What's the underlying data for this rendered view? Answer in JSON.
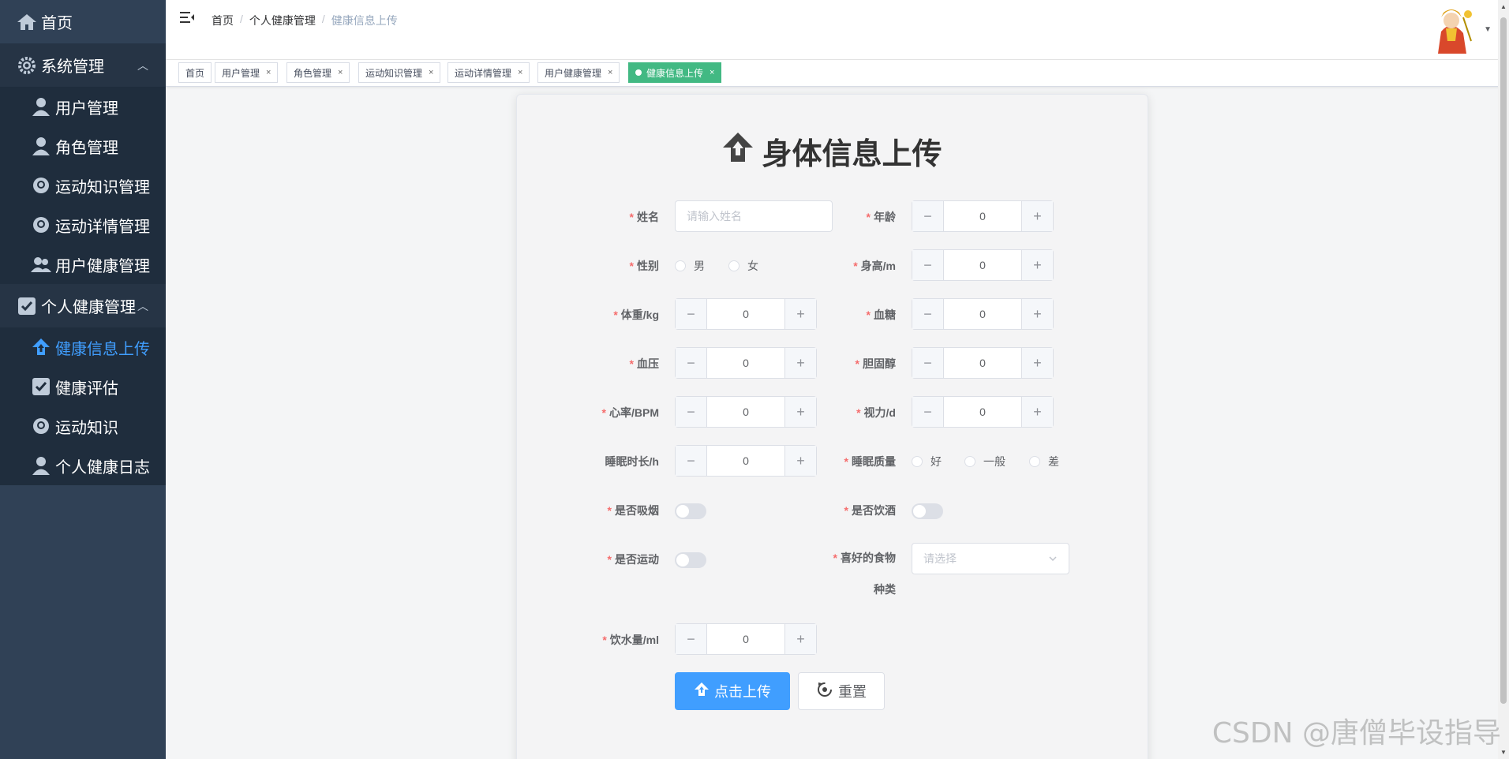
{
  "sidebar": {
    "home": "首页",
    "system": "系统管理",
    "system_items": [
      "用户管理",
      "角色管理",
      "运动知识管理",
      "运动详情管理",
      "用户健康管理"
    ],
    "personal": "个人健康管理",
    "personal_items": [
      "健康信息上传",
      "健康评估",
      "运动知识",
      "个人健康日志"
    ],
    "active_color": "#409eff"
  },
  "breadcrumb": [
    "首页",
    "个人健康管理",
    "健康信息上传"
  ],
  "tags": [
    "首页",
    "用户管理",
    "角色管理",
    "运动知识管理",
    "运动详情管理",
    "用户健康管理",
    "健康信息上传"
  ],
  "form": {
    "title": "身体信息上传",
    "name_label": "姓名",
    "name_placeholder": "请输入姓名",
    "age_label": "年龄",
    "age_value": "0",
    "gender_label": "性别",
    "gender_options": [
      "男",
      "女"
    ],
    "height_label": "身高/m",
    "height_value": "0",
    "weight_label": "体重/kg",
    "weight_value": "0",
    "sugar_label": "血糖",
    "sugar_value": "0",
    "pressure_label": "血压",
    "pressure_value": "0",
    "chol_label": "胆固醇",
    "chol_value": "0",
    "heart_label": "心率/BPM",
    "heart_value": "0",
    "vision_label": "视力/d",
    "vision_value": "0",
    "sleep_label": "睡眠时长/h",
    "sleep_value": "0",
    "quality_label": "睡眠质量",
    "quality_options": [
      "好",
      "一般",
      "差"
    ],
    "smoke_label": "是否吸烟",
    "drink_label": "是否饮酒",
    "sport_label": "是否运动",
    "food_label_1": "喜好的食物",
    "food_label_2": "种类",
    "food_placeholder": "请选择",
    "water_label": "饮水量/ml",
    "water_value": "0",
    "upload_btn": "点击上传",
    "reset_btn": "重置"
  },
  "watermark": "CSDN @唐僧毕设指导"
}
